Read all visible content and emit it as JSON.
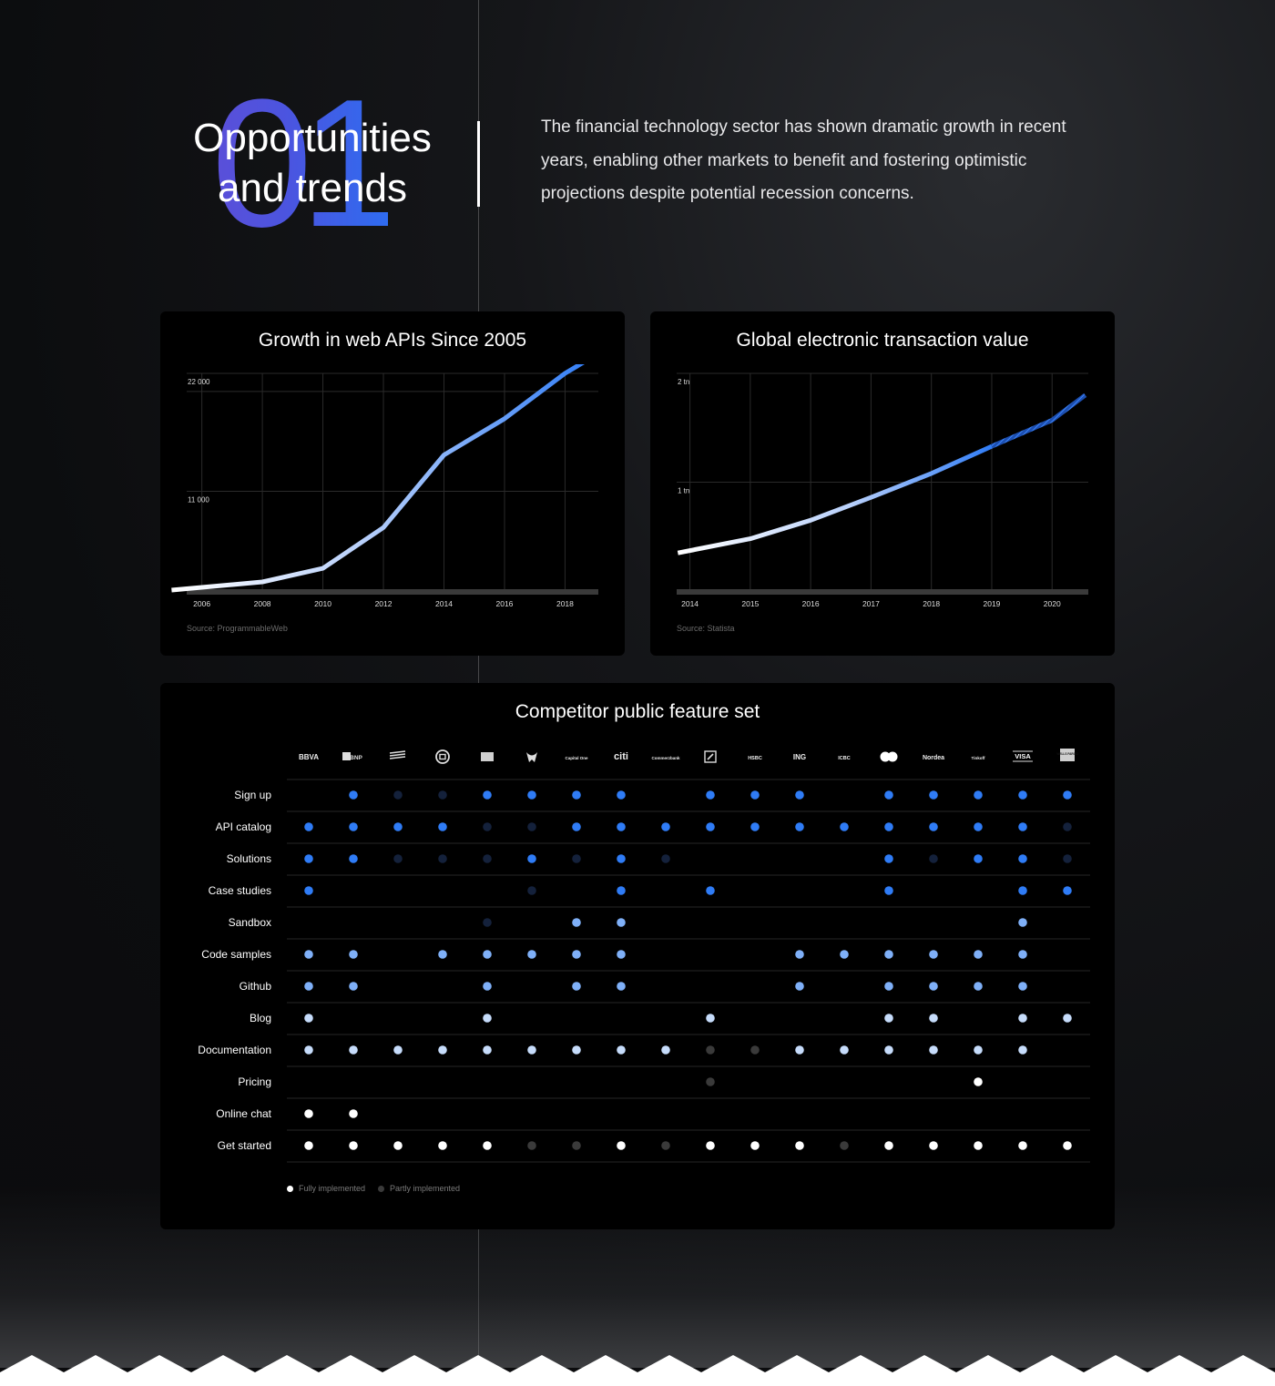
{
  "hero": {
    "number": "01",
    "title_line1": "Opportunities",
    "title_line2": "and trends",
    "description": "The financial technology sector has shown dramatic growth in recent years, enabling other markets to benefit and fostering optimistic projections despite potential recession concerns."
  },
  "chart_data": [
    {
      "type": "line",
      "title": "Growth in web APIs Since 2005",
      "xlabel": "",
      "ylabel": "",
      "x": [
        2005,
        2008,
        2010,
        2012,
        2014,
        2016,
        2018,
        2019
      ],
      "y": [
        100,
        1000,
        2500,
        7000,
        15000,
        19000,
        24000,
        26000
      ],
      "x_ticks": [
        "2006",
        "2008",
        "2010",
        "2012",
        "2014",
        "2016",
        "2018"
      ],
      "y_ticks": [
        "22 000",
        "11 000"
      ],
      "y_tick_values": [
        22000,
        11000
      ],
      "xlim": [
        2005.5,
        2019.1
      ],
      "ylim": [
        0,
        24000
      ],
      "grid": true,
      "source": "Source: ProgrammableWeb"
    },
    {
      "type": "line",
      "title": "Global electronic transaction value",
      "xlabel": "",
      "ylabel": "",
      "x": [
        2013.8,
        2015,
        2016,
        2017,
        2018,
        2019,
        2020,
        2020.55
      ],
      "y": [
        0.35,
        0.48,
        0.65,
        0.86,
        1.08,
        1.33,
        1.57,
        1.8
      ],
      "projection_from": 2019,
      "x_ticks": [
        "2014",
        "2015",
        "2016",
        "2017",
        "2018",
        "2019",
        "2020"
      ],
      "y_ticks": [
        "2 tn",
        "1 tn"
      ],
      "y_tick_values": [
        2,
        1
      ],
      "xlim": [
        2013.78,
        2020.6
      ],
      "ylim": [
        0,
        2
      ],
      "grid": true,
      "source": "Source: Statista"
    }
  ],
  "features": {
    "title": "Competitor public feature set",
    "competitors": [
      "BBVA",
      "BNP",
      "Bank of America",
      "Bank of China",
      "Banco",
      "Barclays",
      "Capital One",
      "citi",
      "Commerzbank",
      "Deutsche Bank",
      "HSBC",
      "ING",
      "ICBC",
      "Mastercard",
      "Nordea",
      "Tinkoff",
      "VISA",
      "Wells Fargo"
    ],
    "competitor_labels": [
      "BBVA",
      "BNP",
      "",
      "",
      "",
      "",
      "Capital One",
      "citi",
      "Commerzbank",
      "",
      "HSBC",
      "ING",
      "ICBC",
      "",
      "Nordea",
      "Tinkoff",
      "VISA",
      "WELLS FARGO"
    ],
    "rows": [
      {
        "label": "Sign up",
        "color": "blue",
        "cells": [
          0,
          2,
          1,
          1,
          2,
          2,
          2,
          2,
          0,
          2,
          2,
          2,
          0,
          2,
          2,
          2,
          2,
          2
        ]
      },
      {
        "label": "API catalog",
        "color": "blue",
        "cells": [
          2,
          2,
          2,
          2,
          1,
          1,
          2,
          2,
          2,
          2,
          2,
          2,
          2,
          2,
          2,
          2,
          2,
          1
        ]
      },
      {
        "label": "Solutions",
        "color": "blue",
        "cells": [
          2,
          2,
          1,
          1,
          1,
          2,
          1,
          2,
          1,
          0,
          0,
          0,
          0,
          2,
          1,
          2,
          2,
          1
        ]
      },
      {
        "label": "Case studies",
        "color": "blue",
        "cells": [
          2,
          0,
          0,
          0,
          0,
          1,
          0,
          2,
          0,
          2,
          0,
          0,
          0,
          2,
          0,
          0,
          2,
          2
        ]
      },
      {
        "label": "Sandbox",
        "color": "lblue",
        "cells": [
          0,
          0,
          0,
          0,
          1,
          0,
          2,
          2,
          0,
          0,
          0,
          0,
          0,
          0,
          0,
          0,
          2,
          0
        ]
      },
      {
        "label": "Code samples",
        "color": "lblue",
        "cells": [
          2,
          2,
          0,
          2,
          2,
          2,
          2,
          2,
          0,
          0,
          0,
          2,
          2,
          2,
          2,
          2,
          2,
          0
        ]
      },
      {
        "label": "Github",
        "color": "lblue",
        "cells": [
          2,
          2,
          0,
          0,
          2,
          0,
          2,
          2,
          0,
          0,
          0,
          2,
          0,
          2,
          2,
          2,
          2,
          0
        ]
      },
      {
        "label": "Blog",
        "color": "pale",
        "cells": [
          2,
          0,
          0,
          0,
          2,
          0,
          0,
          0,
          0,
          2,
          0,
          0,
          0,
          2,
          2,
          0,
          2,
          2
        ]
      },
      {
        "label": "Documentation",
        "color": "pale",
        "cells": [
          2,
          2,
          2,
          2,
          2,
          2,
          2,
          2,
          2,
          1,
          1,
          2,
          2,
          2,
          2,
          2,
          2,
          0
        ]
      },
      {
        "label": "Pricing",
        "color": "white",
        "cells": [
          0,
          0,
          0,
          0,
          0,
          0,
          0,
          0,
          0,
          1,
          0,
          0,
          0,
          0,
          0,
          2,
          0,
          0
        ]
      },
      {
        "label": "Online chat",
        "color": "white",
        "cells": [
          2,
          2,
          0,
          0,
          0,
          0,
          0,
          0,
          0,
          0,
          0,
          0,
          0,
          0,
          0,
          0,
          0,
          0
        ]
      },
      {
        "label": "Get started",
        "color": "white",
        "cells": [
          2,
          2,
          2,
          2,
          2,
          1,
          1,
          2,
          1,
          2,
          2,
          2,
          1,
          2,
          2,
          2,
          2,
          2
        ]
      }
    ],
    "legend_full": "Fully implemented",
    "legend_partial": "Partly implemented"
  },
  "colors": {
    "blue": "#2f7cf6",
    "lblue": "#7fb0f8",
    "pale": "#c6dcfb",
    "white": "#ffffff",
    "partial_blue": "#14213b",
    "partial_gray": "#3a3a3a"
  }
}
